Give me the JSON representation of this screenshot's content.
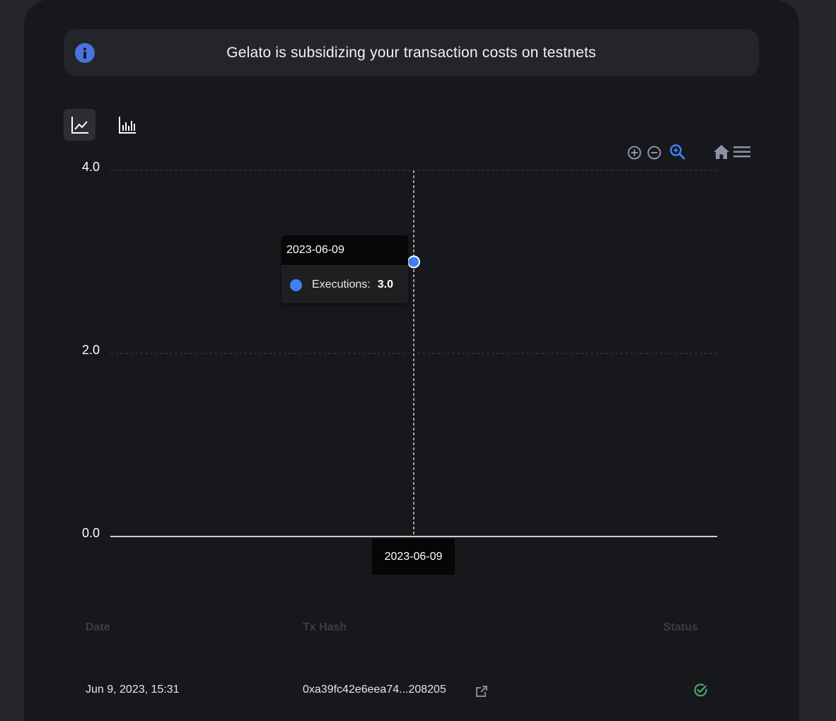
{
  "banner": {
    "text": "Gelato is subsidizing your transaction costs on testnets",
    "icon": "info-icon"
  },
  "view_toggles": [
    {
      "icon": "line-chart-icon",
      "active": true
    },
    {
      "icon": "bar-chart-icon",
      "active": false
    }
  ],
  "chart_toolbar": [
    "zoom-in-icon",
    "zoom-out-icon",
    "selection-zoom-icon",
    "reset-home-icon",
    "menu-icon"
  ],
  "chart_data": {
    "type": "line",
    "x": [
      "2023-06-09"
    ],
    "series": [
      {
        "name": "Executions",
        "values": [
          3.0
        ],
        "color": "#3b82f6"
      }
    ],
    "ylim": [
      0,
      4
    ],
    "y_ticks": [
      "4.0",
      "2.0",
      "0.0"
    ],
    "grid": true
  },
  "tooltip": {
    "date": "2023-06-09",
    "label": "Executions:",
    "value": "3.0"
  },
  "x_crosshair_label": "2023-06-09",
  "table": {
    "headers": {
      "date": "Date",
      "tx_hash": "Tx Hash",
      "status": "Status"
    },
    "rows": [
      {
        "date": "Jun 9, 2023, 15:31",
        "tx_hash": "0xa39fc42e6eea74...208205",
        "status": "success"
      }
    ]
  },
  "colors": {
    "accent": "#3b82f6",
    "success": "#4caf73",
    "panel": "#17181c"
  }
}
